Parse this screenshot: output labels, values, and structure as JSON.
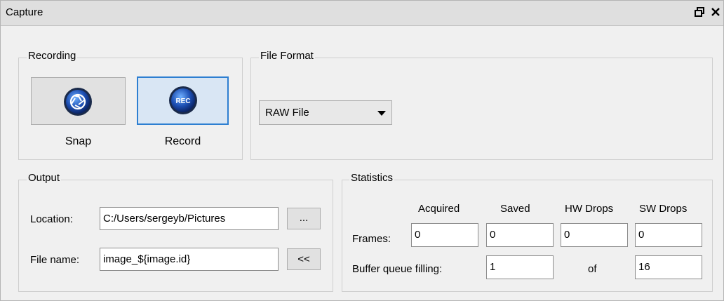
{
  "window": {
    "title": "Capture",
    "float_icon": "restore-icon",
    "close_icon": "close-icon"
  },
  "recording": {
    "title": "Recording",
    "snap_label": "Snap",
    "record_label": "Record",
    "record_icon_text": "REC"
  },
  "file_format": {
    "title": "File Format",
    "selected": "RAW File"
  },
  "output": {
    "title": "Output",
    "location_label": "Location:",
    "location_value": "C:/Users/sergeyb/Pictures",
    "browse_label": "...",
    "filename_label": "File name:",
    "filename_value": "image_${image.id}",
    "insert_label": "<<"
  },
  "statistics": {
    "title": "Statistics",
    "headers": [
      "Acquired",
      "Saved",
      "HW Drops",
      "SW Drops"
    ],
    "frames_label": "Frames:",
    "frames": [
      "0",
      "0",
      "0",
      "0"
    ],
    "buffer_label": "Buffer queue filling:",
    "buffer_value": "1",
    "of_label": "of",
    "buffer_max": "16"
  }
}
